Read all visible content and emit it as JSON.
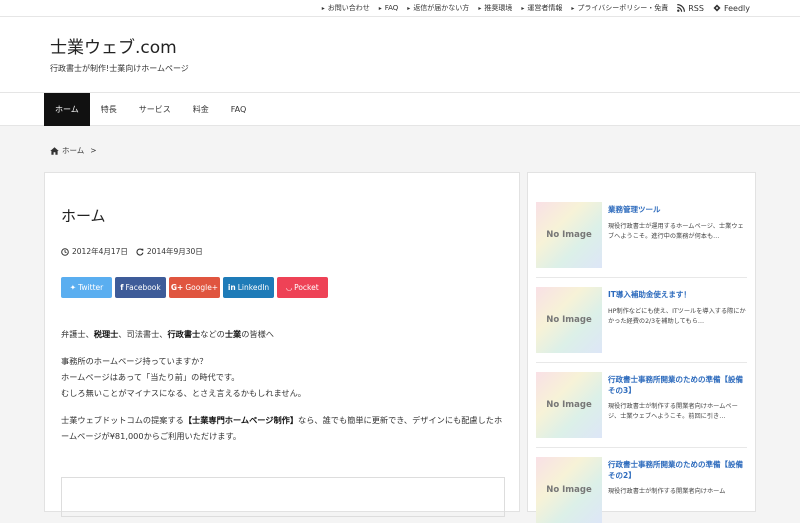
{
  "topbar": {
    "links": [
      "お問い合わせ",
      "FAQ",
      "返信が届かない方",
      "推奨環境",
      "運営者情報",
      "プライバシーポリシー・免責"
    ],
    "rss": "RSS",
    "feedly": "Feedly"
  },
  "header": {
    "title": "士業ウェブ.com",
    "subtitle": "行政書士が制作!士業向けホームページ"
  },
  "nav": {
    "items": [
      "ホーム",
      "特長",
      "サービス",
      "料金",
      "FAQ"
    ],
    "active": "ホーム"
  },
  "breadcrumb": {
    "home": "ホーム",
    "sep": ">"
  },
  "article": {
    "title": "ホーム",
    "published": "2012年4月17日",
    "updated": "2014年9月30日",
    "share": {
      "twitter": "Twitter",
      "facebook": "Facebook",
      "googleplus": "Google+",
      "linkedin": "LinkedIn",
      "pocket": "Pocket"
    },
    "p1": {
      "a": "弁護士、",
      "b": "税理士",
      "c": "、司法書士、",
      "d": "行政書士",
      "e": "などの",
      "f": "士業",
      "g": "の皆様へ"
    },
    "p2": {
      "l1": "事務所のホームページ持っていますか？",
      "l2": "ホームページはあって「当たり前」の時代です。",
      "l3": "むしろ無いことがマイナスになる、とさえ言えるかもしれません。"
    },
    "p3": {
      "a": "士業ウェブドットコムの提案する",
      "b": "【士業専門ホームページ制作】",
      "c": "なら、誰でも簡単に更新でき、デザインにも配慮したホームページが¥81,000からご利用いただけます。"
    }
  },
  "sidebar": {
    "no_image": "No Image",
    "items": [
      {
        "title": "業務管理ツール",
        "desc": "現役行政書士が運用するホームページ、士業ウェブへようこそ。進行中の業務が何本も…"
      },
      {
        "title": "IT導入補助金使えます！",
        "desc": "HP制作などにも使え、ITツールを導入する際にかかった経費の2/3を補助してもら…"
      },
      {
        "title": "行政書士事務所開業のための準備【設備その3】",
        "desc": "現役行政書士が制作する開業者向けホームページ、士業ウェブへようこそ。前回に引き…"
      },
      {
        "title": "行政書士事務所開業のための準備【設備その2】",
        "desc": "現役行政書士が制作する開業者向けホーム"
      }
    ]
  },
  "colors": {
    "twitter": "#5aaef0",
    "facebook": "#3e5c99",
    "googleplus": "#e0553f",
    "linkedin": "#1e7bb8",
    "pocket": "#ee4256",
    "link": "#2d6bbd"
  }
}
